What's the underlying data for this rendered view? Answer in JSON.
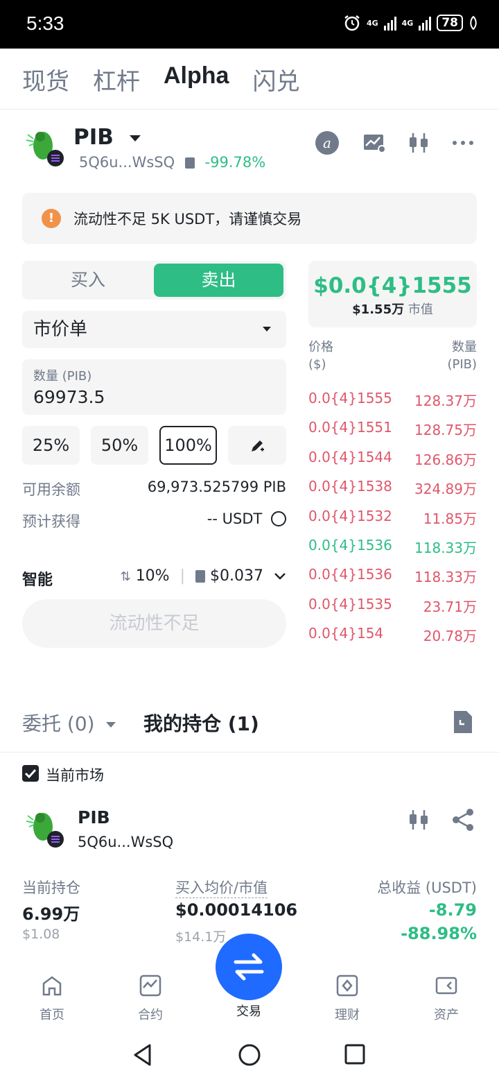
{
  "status_bar": {
    "time": "5:33",
    "battery": "78",
    "network1": "4G",
    "network2": "4G"
  },
  "top_tabs": [
    {
      "label": "现货",
      "active": false
    },
    {
      "label": "杠杆",
      "active": false
    },
    {
      "label": "Alpha",
      "active": true
    },
    {
      "label": "闪兑",
      "active": false
    }
  ],
  "token": {
    "symbol": "PIB",
    "address": "5Q6u...WsSQ",
    "change": "-99.78%",
    "header_icons": [
      "alpha-icon",
      "chart-settings-icon",
      "candlestick-icon",
      "more-icon"
    ]
  },
  "warning": {
    "icon": "!",
    "text": "流动性不足 5K USDT，请谨慎交易"
  },
  "order_form": {
    "buy_label": "买入",
    "sell_label": "卖出",
    "order_type": "市价单",
    "quantity_label": "数量 (PIB)",
    "quantity_value": "69973.5",
    "percent_buttons": [
      "25%",
      "50%",
      "100%"
    ],
    "selected_percent": "100%",
    "available_label": "可用余额",
    "available_value": "69,973.525799 PIB",
    "estimate_label": "预计获得",
    "estimate_value": "-- USDT",
    "smart_label": "智能",
    "slippage": "10%",
    "gas": "$0.037",
    "submit_label": "流动性不足"
  },
  "price_box": {
    "price": "$0.0{4}1555",
    "market_cap": "$1.55万",
    "market_cap_label": "市值"
  },
  "order_book": {
    "price_header": "价格",
    "price_unit": "($)",
    "qty_header": "数量",
    "qty_unit": "(PIB)",
    "rows": [
      {
        "price": "0.0{4}1555",
        "qty": "128.37万",
        "side": "sell"
      },
      {
        "price": "0.0{4}1551",
        "qty": "128.75万",
        "side": "sell"
      },
      {
        "price": "0.0{4}1544",
        "qty": "126.86万",
        "side": "sell"
      },
      {
        "price": "0.0{4}1538",
        "qty": "324.89万",
        "side": "sell"
      },
      {
        "price": "0.0{4}1532",
        "qty": "11.85万",
        "side": "sell"
      },
      {
        "price": "0.0{4}1536",
        "qty": "118.33万",
        "side": "buy"
      },
      {
        "price": "0.0{4}1536",
        "qty": "118.33万",
        "side": "sell"
      },
      {
        "price": "0.0{4}1535",
        "qty": "23.71万",
        "side": "sell"
      },
      {
        "price": "0.0{4}154",
        "qty": "20.78万",
        "side": "sell"
      }
    ]
  },
  "positions": {
    "tab_orders": "委托 (0)",
    "tab_holdings": "我的持仓 (1)",
    "current_market_label": "当前市场",
    "item": {
      "symbol": "PIB",
      "address": "5Q6u...WsSQ",
      "holding_label": "当前持仓",
      "holding_value": "6.99万",
      "holding_usd": "$1.08",
      "avg_label": "买入均价/市值",
      "avg_value": "$0.00014106",
      "avg_mcap": "$14.1万",
      "pnl_label": "总收益 (USDT)",
      "pnl_value": "-8.79",
      "pnl_pct": "-88.98%"
    }
  },
  "bottom_nav": [
    {
      "label": "首页",
      "icon": "home-icon"
    },
    {
      "label": "合约",
      "icon": "futures-icon"
    },
    {
      "label": "交易",
      "icon": "trade-icon",
      "active": true
    },
    {
      "label": "理财",
      "icon": "earn-icon"
    },
    {
      "label": "资产",
      "icon": "wallet-icon"
    }
  ],
  "colors": {
    "green": "#2ebd85",
    "red": "#e0566a",
    "fab_blue": "#1f6bff",
    "warning_orange": "#f0924a"
  }
}
